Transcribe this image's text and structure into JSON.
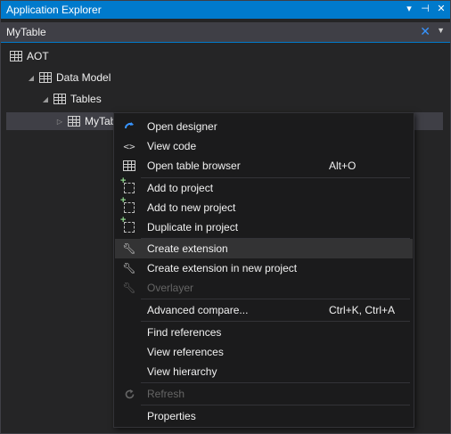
{
  "window": {
    "title": "Application Explorer",
    "controls": {
      "dropdown": "▾",
      "pin": "⊣",
      "close": "✕"
    }
  },
  "search": {
    "value": "MyTable",
    "clear": "✕",
    "dropdown": "▼"
  },
  "tree": {
    "aot": {
      "label": "AOT"
    },
    "data_model": {
      "label": "Data Model"
    },
    "tables": {
      "label": "Tables"
    },
    "mytable": {
      "label": "MyTab"
    }
  },
  "context_menu": {
    "items": [
      {
        "label": "Open designer",
        "icon": "open-designer-icon"
      },
      {
        "label": "View code",
        "icon": "code-icon"
      },
      {
        "label": "Open table browser",
        "shortcut": "Alt+O",
        "icon": "table-icon"
      },
      {
        "label": "Add to project",
        "icon": "add-to-project-icon"
      },
      {
        "label": "Add to new project",
        "icon": "add-to-project-icon"
      },
      {
        "label": "Duplicate in project",
        "icon": "add-to-project-icon"
      },
      {
        "label": "Create extension",
        "icon": "wrench-icon",
        "highlighted": true
      },
      {
        "label": "Create extension in new project",
        "icon": "wrench-icon"
      },
      {
        "label": "Overlayer",
        "icon": "wrench-icon",
        "disabled": true
      },
      {
        "label": "Advanced compare...",
        "shortcut": "Ctrl+K, Ctrl+A"
      },
      {
        "label": "Find references"
      },
      {
        "label": "View references"
      },
      {
        "label": "View hierarchy"
      },
      {
        "label": "Refresh",
        "icon": "refresh-icon",
        "disabled": true
      },
      {
        "label": "Properties"
      }
    ]
  },
  "colors": {
    "accent": "#007acc",
    "background": "#252526",
    "menu_bg": "#1b1b1c",
    "highlight": "#333334",
    "disabled_text": "#656565"
  }
}
